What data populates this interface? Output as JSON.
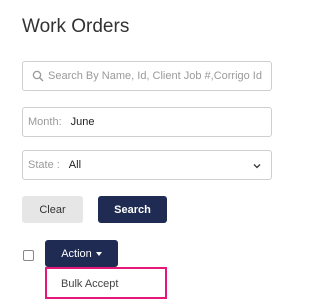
{
  "header": {
    "title": "Work Orders"
  },
  "filters": {
    "search_placeholder": "Search By Name, Id, Client Job #,Corrigo Id",
    "month_label": "Month:",
    "month_value": "June",
    "state_label": "State :",
    "state_value": "All"
  },
  "buttons": {
    "clear": "Clear",
    "search": "Search",
    "action": "Action"
  },
  "action_menu": {
    "items": [
      "Bulk Accept"
    ]
  },
  "colors": {
    "primary": "#1f2b52",
    "highlight": "#e8177a"
  }
}
